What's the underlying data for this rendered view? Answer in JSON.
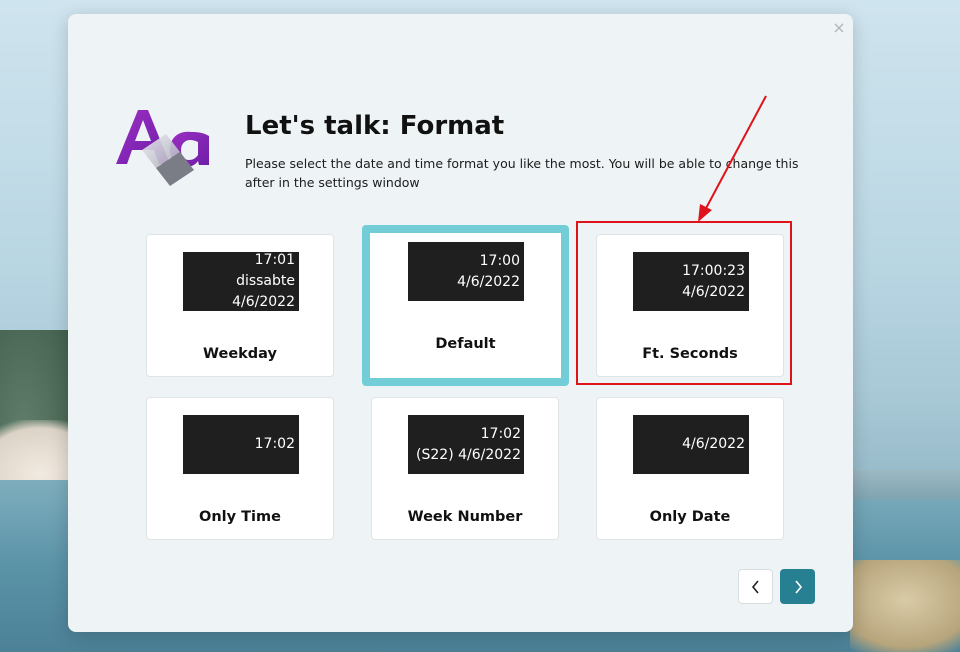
{
  "dialog": {
    "title": "Let's talk: Format",
    "description": "Please select the date and time format you like the most. You will be able to change this after in the settings window",
    "close_glyph": "×",
    "logo_icon": "font-style-icon"
  },
  "formats": [
    {
      "label": "Weekday",
      "preview": [
        "17:01",
        "dissabte",
        "4/6/2022"
      ],
      "selected": false
    },
    {
      "label": "Default",
      "preview": [
        "17:00",
        "4/6/2022"
      ],
      "selected": true
    },
    {
      "label": "Ft. Seconds",
      "preview": [
        "17:00:23",
        "4/6/2022"
      ],
      "selected": false,
      "highlighted": true
    },
    {
      "label": "Only Time",
      "preview": [
        "17:02"
      ],
      "selected": false
    },
    {
      "label": "Week Number",
      "preview": [
        "17:02",
        "(S22) 4/6/2022"
      ],
      "selected": false
    },
    {
      "label": "Only Date",
      "preview": [
        "4/6/2022"
      ],
      "selected": false
    }
  ],
  "navigation": {
    "prev_icon": "chevron-left-icon",
    "next_icon": "chevron-right-icon"
  },
  "colors": {
    "selected_border": "#73cdd6",
    "next_button": "#277f92",
    "highlight": "#e0121b",
    "preview_bg": "#1f1f1f"
  }
}
